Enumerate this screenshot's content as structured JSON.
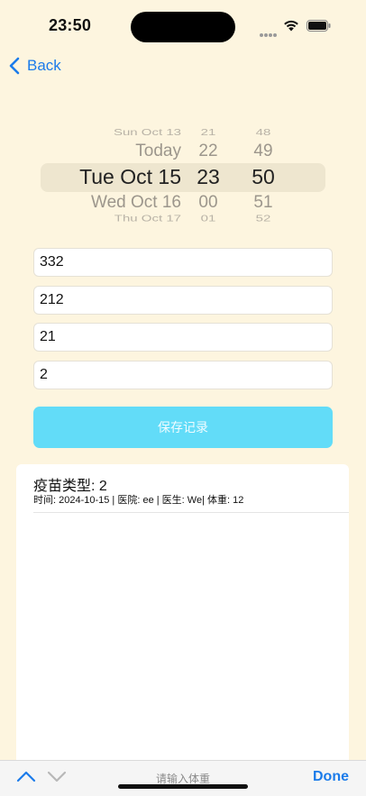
{
  "status_bar": {
    "time": "23:50"
  },
  "nav": {
    "back_label": "Back"
  },
  "picker": {
    "date": [
      "Sun Oct 13",
      "Today",
      "Tue Oct 15",
      "Wed Oct 16",
      "Thu Oct 17"
    ],
    "hour": [
      "21",
      "22",
      "23",
      "00",
      "01"
    ],
    "minute": [
      "48",
      "49",
      "50",
      "51",
      "52"
    ],
    "selected": {
      "date": "Tue Oct 15",
      "hour": "23",
      "minute": "50"
    }
  },
  "form": {
    "field1": "332",
    "field2": "212",
    "field3": "21",
    "field4": "2",
    "save_label": "保存记录"
  },
  "records": [
    {
      "title": "疫苗类型: 2",
      "detail": "时间: 2024-10-15 | 医院: ee | 医生: We| 体重: 12"
    }
  ],
  "keyboard_toolbar": {
    "placeholder": "请输入体重",
    "done_label": "Done"
  },
  "colors": {
    "background": "#FDF5DF",
    "accent": "#1B7BEA",
    "save_button": "#62DCF8"
  }
}
